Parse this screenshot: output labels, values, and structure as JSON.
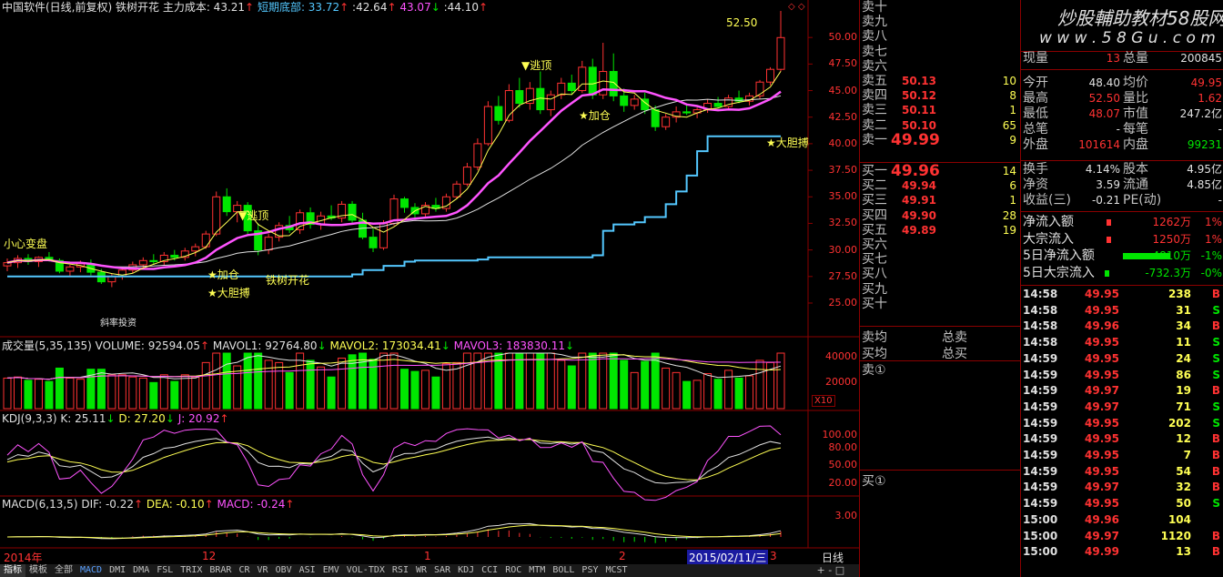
{
  "header": {
    "title": "中国软件(日线,前复权) 铁树开花",
    "cost_label": "主力成本: 43.21",
    "short_bottom": "短期底部: 33.72",
    "v2": "42.64",
    "v3": "43.07",
    "v4": "44.10"
  },
  "price_axis": [
    "50.00",
    "47.50",
    "45.00",
    "42.50",
    "40.00",
    "37.50",
    "35.00",
    "32.50",
    "30.00",
    "27.50",
    "25.00"
  ],
  "vol_axis": [
    "40000",
    "20000"
  ],
  "vol_unit": "X10",
  "kdj_axis": [
    "100.00",
    "80.00",
    "50.00",
    "20.00"
  ],
  "macd_axis": [
    "3.00"
  ],
  "annotations": {
    "high_label": "52.50",
    "escape_top_1": "▼逃顶",
    "escape_top_2": "▼逃顶",
    "add_pos_1": "★加仓",
    "add_pos_2": "★加仓",
    "bold_buy_1": "★大胆搏",
    "bold_buy_2": "★大胆搏",
    "careful": "小心变盘",
    "tree": "铁树开花",
    "low_label": "斜率投资"
  },
  "volume_header": {
    "name": "成交量(5,35,135) VOLUME: 92594.05",
    "mavol1": "MAVOL1: 92764.80",
    "mavol2": "MAVOL2: 173034.41",
    "mavol3": "MAVOL3: 183830.11"
  },
  "kdj_header": {
    "name": "KDJ(9,3,3)",
    "k": "K: 25.11",
    "d": "D: 27.20",
    "j": "J: 20.92"
  },
  "macd_header": {
    "name": "MACD(6,13,5)",
    "dif": "DIF: -0.22",
    "dea": "DEA: -0.10",
    "macd": "MACD: -0.24"
  },
  "date_axis": {
    "year": "2014年",
    "m12": "12",
    "m1": "1",
    "m2": "2",
    "cursor": "2015/02/11/三",
    "m3": "3",
    "period": "日线"
  },
  "tabs": [
    "指标",
    "模板",
    "全部",
    "MACD",
    "DMI",
    "DMA",
    "FSL",
    "TRIX",
    "BRAR",
    "CR",
    "VR",
    "OBV",
    "ASI",
    "EMV",
    "VOL-TDX",
    "RSI",
    "WR",
    "SAR",
    "KDJ",
    "CCI",
    "ROC",
    "MTM",
    "BOLL",
    "PSY",
    "MCST"
  ],
  "book": {
    "sells": [
      {
        "label": "卖十",
        "price": "",
        "vol": ""
      },
      {
        "label": "卖九",
        "price": "",
        "vol": ""
      },
      {
        "label": "卖八",
        "price": "",
        "vol": ""
      },
      {
        "label": "卖七",
        "price": "",
        "vol": ""
      },
      {
        "label": "卖六",
        "price": "",
        "vol": ""
      },
      {
        "label": "卖五",
        "price": "50.13",
        "vol": "10"
      },
      {
        "label": "卖四",
        "price": "50.12",
        "vol": "8"
      },
      {
        "label": "卖三",
        "price": "50.11",
        "vol": "1"
      },
      {
        "label": "卖二",
        "price": "50.10",
        "vol": "65"
      },
      {
        "label": "卖一",
        "price": "49.99",
        "vol": "9"
      }
    ],
    "buys": [
      {
        "label": "买一",
        "price": "49.96",
        "vol": "14"
      },
      {
        "label": "买二",
        "price": "49.94",
        "vol": "6"
      },
      {
        "label": "买三",
        "price": "49.91",
        "vol": "1"
      },
      {
        "label": "买四",
        "price": "49.90",
        "vol": "28"
      },
      {
        "label": "买五",
        "price": "49.89",
        "vol": "19"
      },
      {
        "label": "买六",
        "price": "",
        "vol": ""
      },
      {
        "label": "买七",
        "price": "",
        "vol": ""
      },
      {
        "label": "买八",
        "price": "",
        "vol": ""
      },
      {
        "label": "买九",
        "price": "",
        "vol": ""
      },
      {
        "label": "买十",
        "price": "",
        "vol": ""
      }
    ],
    "avg_sell": "卖均",
    "total_sell": "总卖",
    "avg_buy": "买均",
    "total_buy": "总买",
    "sell1": "卖①",
    "buy1": "买①"
  },
  "quote": {
    "brand": "炒股輔助教材58股网",
    "site": "w w w . 5 8 G u . c o m",
    "rows": [
      {
        "l1": "现量",
        "v1": "13",
        "l2": "总量",
        "v2": "200845",
        "c1": "red",
        "c2": "wht"
      },
      {
        "l1": "今开",
        "v1": "48.40",
        "l2": "均价",
        "v2": "49.95",
        "c1": "wht",
        "c2": "red"
      },
      {
        "l1": "最高",
        "v1": "52.50",
        "l2": "量比",
        "v2": "1.62",
        "c1": "red",
        "c2": "red"
      },
      {
        "l1": "最低",
        "v1": "48.07",
        "l2": "市值",
        "v2": "247.2亿",
        "c1": "red",
        "c2": "wht"
      },
      {
        "l1": "总笔",
        "v1": "-",
        "l2": "每笔",
        "v2": "-",
        "c1": "wht",
        "c2": "wht"
      },
      {
        "l1": "外盘",
        "v1": "101614",
        "l2": "内盘",
        "v2": "99231",
        "c1": "red",
        "c2": "grn"
      },
      {
        "l1": "换手",
        "v1": "4.14%",
        "l2": "股本",
        "v2": "4.95亿",
        "c1": "wht",
        "c2": "wht"
      },
      {
        "l1": "净资",
        "v1": "3.59",
        "l2": "流通",
        "v2": "4.85亿",
        "c1": "wht",
        "c2": "wht"
      },
      {
        "l1": "收益(三)",
        "v1": "-0.21",
        "l2": "PE(动)",
        "v2": "-",
        "c1": "wht",
        "c2": "wht"
      }
    ],
    "flows": [
      {
        "label": "净流入额",
        "value": "1262万",
        "pct": "1%",
        "color": "red"
      },
      {
        "label": "大宗流入",
        "value": "1250万",
        "pct": "1%",
        "color": "red"
      },
      {
        "label": "5日净流入额",
        "value": "-4810万",
        "pct": "-1%",
        "color": "grn"
      },
      {
        "label": "5日大宗流入",
        "value": "-732.3万",
        "pct": "-0%",
        "color": "grn"
      }
    ],
    "ticks": [
      {
        "t": "14:58",
        "p": "49.95",
        "v": "238",
        "s": "B"
      },
      {
        "t": "14:58",
        "p": "49.95",
        "v": "31",
        "s": "S"
      },
      {
        "t": "14:58",
        "p": "49.96",
        "v": "34",
        "s": "B"
      },
      {
        "t": "14:58",
        "p": "49.95",
        "v": "11",
        "s": "S"
      },
      {
        "t": "14:59",
        "p": "49.95",
        "v": "24",
        "s": "S"
      },
      {
        "t": "14:59",
        "p": "49.95",
        "v": "86",
        "s": "S"
      },
      {
        "t": "14:59",
        "p": "49.97",
        "v": "19",
        "s": "B"
      },
      {
        "t": "14:59",
        "p": "49.97",
        "v": "71",
        "s": "S"
      },
      {
        "t": "14:59",
        "p": "49.95",
        "v": "202",
        "s": "S"
      },
      {
        "t": "14:59",
        "p": "49.95",
        "v": "12",
        "s": "B"
      },
      {
        "t": "14:59",
        "p": "49.95",
        "v": "7",
        "s": "B"
      },
      {
        "t": "14:59",
        "p": "49.95",
        "v": "54",
        "s": "B"
      },
      {
        "t": "14:59",
        "p": "49.97",
        "v": "32",
        "s": "B"
      },
      {
        "t": "14:59",
        "p": "49.95",
        "v": "50",
        "s": "S"
      },
      {
        "t": "15:00",
        "p": "49.96",
        "v": "104",
        "s": ""
      },
      {
        "t": "15:00",
        "p": "49.97",
        "v": "1120",
        "s": "B"
      },
      {
        "t": "15:00",
        "p": "49.99",
        "v": "13",
        "s": "B"
      }
    ]
  },
  "colors": {
    "up": "#ff3232",
    "down": "#00e600",
    "ma5": "#ffff54",
    "ma10": "#ff54ff",
    "ma20": "#e0e0e0",
    "support": "#54c8ff",
    "grid": "#8b0000"
  },
  "chart_data": {
    "type": "candlestick",
    "ylim": [
      22,
      52.5
    ],
    "candles": [
      [
        28.5,
        29.2,
        28.0,
        28.8
      ],
      [
        28.8,
        29.5,
        28.3,
        29.2
      ],
      [
        29.2,
        29.6,
        28.6,
        28.9
      ],
      [
        28.9,
        29.4,
        28.4,
        29.3
      ],
      [
        29.3,
        29.8,
        28.9,
        29.0
      ],
      [
        29.0,
        29.2,
        27.8,
        28.0
      ],
      [
        28.0,
        28.6,
        27.5,
        28.4
      ],
      [
        28.4,
        29.0,
        27.9,
        28.7
      ],
      [
        28.7,
        29.1,
        27.6,
        27.9
      ],
      [
        27.9,
        28.2,
        26.8,
        27.0
      ],
      [
        27.0,
        27.8,
        26.5,
        27.5
      ],
      [
        27.5,
        28.4,
        27.2,
        28.1
      ],
      [
        28.1,
        28.9,
        27.8,
        28.6
      ],
      [
        28.6,
        29.3,
        28.2,
        29.0
      ],
      [
        29.0,
        29.6,
        28.6,
        28.9
      ],
      [
        28.9,
        29.8,
        28.6,
        29.5
      ],
      [
        29.5,
        30.0,
        29.0,
        29.3
      ],
      [
        29.3,
        30.2,
        29.0,
        29.9
      ],
      [
        29.9,
        30.6,
        29.4,
        30.3
      ],
      [
        30.3,
        31.8,
        30.1,
        31.5
      ],
      [
        31.5,
        35.5,
        31.3,
        35.0
      ],
      [
        35.0,
        35.8,
        33.2,
        33.6
      ],
      [
        33.6,
        34.6,
        32.6,
        34.2
      ],
      [
        34.2,
        34.5,
        31.5,
        31.8
      ],
      [
        31.8,
        32.5,
        29.5,
        30.0
      ],
      [
        30.0,
        31.5,
        29.6,
        31.2
      ],
      [
        31.2,
        32.6,
        30.8,
        32.3
      ],
      [
        32.3,
        33.2,
        31.6,
        31.9
      ],
      [
        31.9,
        33.8,
        31.5,
        33.5
      ],
      [
        33.5,
        34.0,
        32.0,
        32.4
      ],
      [
        32.4,
        33.6,
        31.9,
        33.2
      ],
      [
        33.2,
        34.2,
        32.8,
        33.0
      ],
      [
        33.0,
        34.6,
        32.6,
        34.3
      ],
      [
        34.3,
        34.6,
        32.5,
        32.8
      ],
      [
        32.8,
        33.5,
        31.0,
        31.2
      ],
      [
        31.2,
        32.0,
        29.8,
        30.2
      ],
      [
        30.2,
        32.8,
        30.0,
        32.5
      ],
      [
        32.5,
        35.2,
        32.3,
        34.8
      ],
      [
        34.8,
        35.0,
        33.5,
        34.0
      ],
      [
        34.0,
        34.4,
        32.9,
        33.4
      ],
      [
        33.4,
        34.5,
        33.1,
        34.2
      ],
      [
        34.2,
        34.9,
        33.6,
        33.9
      ],
      [
        33.9,
        35.3,
        33.6,
        35.0
      ],
      [
        35.0,
        36.5,
        34.8,
        36.2
      ],
      [
        36.2,
        38.2,
        36.0,
        37.8
      ],
      [
        37.8,
        40.5,
        37.5,
        40.0
      ],
      [
        40.0,
        44.0,
        39.8,
        43.5
      ],
      [
        43.5,
        44.5,
        41.8,
        42.2
      ],
      [
        42.2,
        45.6,
        42.0,
        45.0
      ],
      [
        45.0,
        46.2,
        43.4,
        43.8
      ],
      [
        43.8,
        45.8,
        43.2,
        45.2
      ],
      [
        45.2,
        46.8,
        42.8,
        43.2
      ],
      [
        43.2,
        45.0,
        42.6,
        44.6
      ],
      [
        44.6,
        46.2,
        44.2,
        45.7
      ],
      [
        45.7,
        46.5,
        44.6,
        45.0
      ],
      [
        45.0,
        47.8,
        44.8,
        47.2
      ],
      [
        47.2,
        48.0,
        44.2,
        44.6
      ],
      [
        44.6,
        49.5,
        44.2,
        46.8
      ],
      [
        46.8,
        48.5,
        44.0,
        44.5
      ],
      [
        44.5,
        45.2,
        43.0,
        43.6
      ],
      [
        43.6,
        44.6,
        43.2,
        44.2
      ],
      [
        44.2,
        44.8,
        42.8,
        43.2
      ],
      [
        43.2,
        43.6,
        41.2,
        41.6
      ],
      [
        41.6,
        42.8,
        41.3,
        42.5
      ],
      [
        42.5,
        43.5,
        42.0,
        43.0
      ],
      [
        43.0,
        43.8,
        42.7,
        42.9
      ],
      [
        42.9,
        43.4,
        42.4,
        43.2
      ],
      [
        43.2,
        44.2,
        42.9,
        43.8
      ],
      [
        43.8,
        44.4,
        43.3,
        43.5
      ],
      [
        43.5,
        44.6,
        43.2,
        44.3
      ],
      [
        44.3,
        45.0,
        43.8,
        44.0
      ],
      [
        44.0,
        44.8,
        43.6,
        44.5
      ],
      [
        44.5,
        46.0,
        44.2,
        45.8
      ],
      [
        45.8,
        47.2,
        45.5,
        47.0
      ],
      [
        47.0,
        52.5,
        46.8,
        49.99
      ]
    ]
  }
}
